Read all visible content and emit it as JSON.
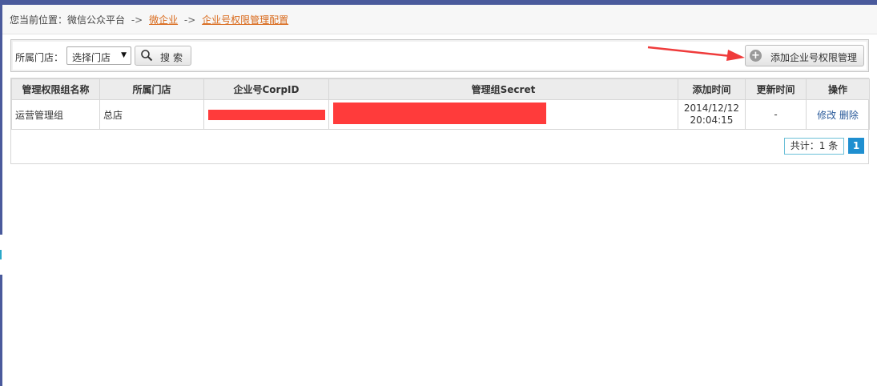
{
  "breadcrumb": {
    "prefix": "您当前位置：微信公众平台",
    "sep1": "->",
    "link1": "微企业",
    "sep2": "->",
    "link2": "企业号权限管理配置"
  },
  "toolbar": {
    "store_label": "所属门店：",
    "store_select_value": "选择门店",
    "search_label": "搜索",
    "add_label": "添加企业号权限管理"
  },
  "table": {
    "headers": [
      "管理权限组名称",
      "所属门店",
      "企业号CorpID",
      "管理组Secret",
      "添加时间",
      "更新时间",
      "操作"
    ],
    "rows": [
      {
        "name": "运营管理组",
        "store": "总店",
        "corp_id": "",
        "secret": "",
        "added_date": "2014/12/12",
        "added_time": "20:04:15",
        "updated": "-",
        "edit_label": "修改",
        "delete_label": "删除"
      }
    ]
  },
  "pager": {
    "total": "共计：1 条",
    "current_page": "1"
  },
  "colors": {
    "accent_link": "#d9691a",
    "redaction": "#ff3b3b",
    "page_active": "#1f8fd0",
    "annotation_arrow": "#ef3b3b"
  }
}
